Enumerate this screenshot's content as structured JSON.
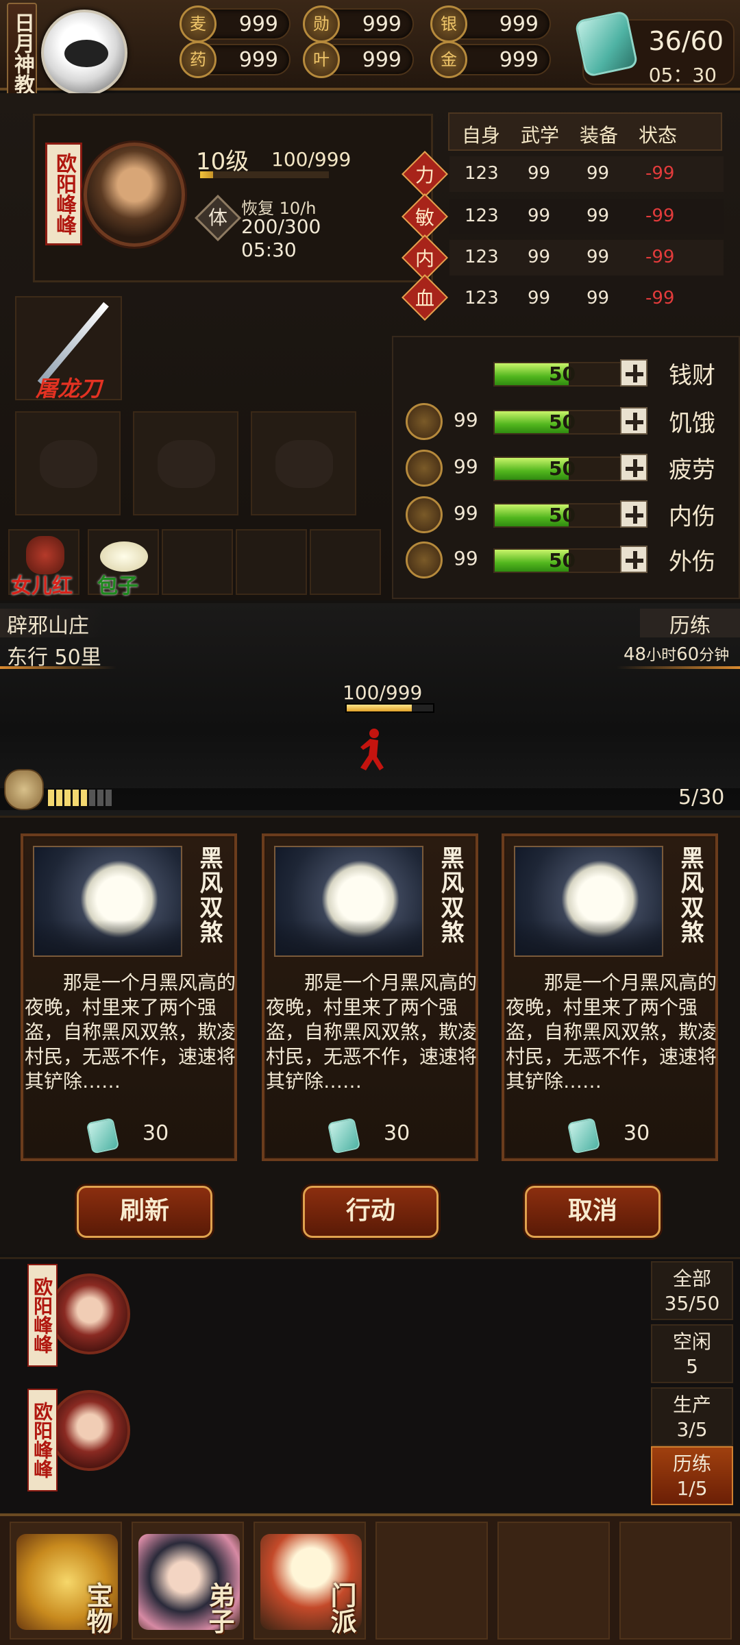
{
  "top_bar": {
    "sect_name": "日月神教",
    "resources": [
      {
        "icon": "wheat-icon",
        "glyph": "麦",
        "value": "999"
      },
      {
        "icon": "medal-icon",
        "glyph": "勋",
        "value": "999"
      },
      {
        "icon": "silver-ingot-icon",
        "glyph": "银",
        "value": "999"
      },
      {
        "icon": "herb-icon",
        "glyph": "药",
        "value": "999"
      },
      {
        "icon": "leaf-icon",
        "glyph": "叶",
        "value": "999"
      },
      {
        "icon": "gold-ingot-icon",
        "glyph": "金",
        "value": "999"
      }
    ],
    "stamina": "36/60",
    "stamina_timer": "05：30"
  },
  "character": {
    "name": "欧阳峰峰",
    "level": "10级",
    "exp": "100/999",
    "exp_fill": 0.1,
    "ti_label": "体",
    "regen": "恢复 10/h",
    "hp": "200/300",
    "regen_time": "05:30"
  },
  "stats": {
    "headers": [
      "自身",
      "武学",
      "装备",
      "状态"
    ],
    "rows": [
      {
        "label": "力",
        "base": "123",
        "martial": "99",
        "gear": "99",
        "state": "-99"
      },
      {
        "label": "敏",
        "base": "123",
        "martial": "99",
        "gear": "99",
        "state": "-99"
      },
      {
        "label": "内",
        "base": "123",
        "martial": "99",
        "gear": "99",
        "state": "-99"
      },
      {
        "label": "血",
        "base": "123",
        "martial": "99",
        "gear": "99",
        "state": "-99"
      }
    ]
  },
  "equipment": {
    "weapon_name": "屠龙刀",
    "items": [
      {
        "label": "女儿红"
      },
      {
        "label": "包子"
      }
    ]
  },
  "needs": [
    {
      "icon": "",
      "num": "",
      "value": "50",
      "fill": 0.5,
      "label": "钱财"
    },
    {
      "icon": "wheat-icon",
      "num": "99",
      "value": "50",
      "fill": 0.5,
      "label": "饥饿"
    },
    {
      "icon": "medal-icon",
      "num": "99",
      "value": "50",
      "fill": 0.5,
      "label": "疲劳"
    },
    {
      "icon": "herb-icon",
      "num": "99",
      "value": "50",
      "fill": 0.5,
      "label": "内伤"
    },
    {
      "icon": "leaf-icon",
      "num": "99",
      "value": "50",
      "fill": 0.5,
      "label": "外伤"
    }
  ],
  "journey": {
    "location": "辟邪山庄",
    "direction": "东行 50里",
    "mode": "历练",
    "eta_hours": "48",
    "eta_h_unit": "小时",
    "eta_minutes": "60",
    "eta_m_unit": "分钟",
    "progress": "100/999",
    "progress_fill": 0.75,
    "segments_on": 5,
    "segments_total": 8,
    "count": "5/30"
  },
  "cards": [
    {
      "title": "黑风双煞",
      "desc": "那是一个月黑风高的夜晚，村里来了两个强盗，自称黑风双煞，欺凌村民，无恶不作，速速将其铲除……",
      "cost": "30"
    },
    {
      "title": "黑风双煞",
      "desc": "那是一个月黑风高的夜晚，村里来了两个强盗，自称黑风双煞，欺凌村民，无恶不作，速速将其铲除……",
      "cost": "30"
    },
    {
      "title": "黑风双煞",
      "desc": "那是一个月黑风高的夜晚，村里来了两个强盗，自称黑风双煞，欺凌村民，无恶不作，速速将其铲除……",
      "cost": "30"
    }
  ],
  "buttons": {
    "refresh": "刷新",
    "act": "行动",
    "cancel": "取消"
  },
  "disciples": [
    {
      "name": "欧阳峰峰"
    },
    {
      "name": "欧阳峰峰"
    }
  ],
  "filters": [
    {
      "label": "全部",
      "count": "35/50",
      "active": false
    },
    {
      "label": "空闲",
      "count": "5",
      "active": false
    },
    {
      "label": "生产",
      "count": "3/5",
      "active": false
    },
    {
      "label": "历练",
      "count": "1/5",
      "active": true
    }
  ],
  "bottom_nav": [
    {
      "label": "宝物",
      "icon": "treasure-chest-icon"
    },
    {
      "label": "弟子",
      "icon": "disciple-icon"
    },
    {
      "label": "门派",
      "icon": "sect-hall-icon"
    }
  ]
}
